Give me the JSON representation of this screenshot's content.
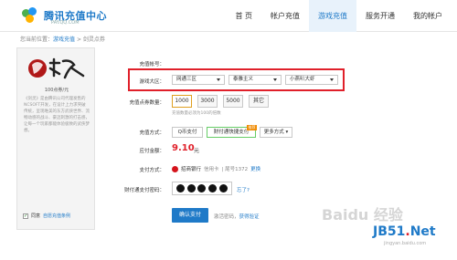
{
  "header": {
    "brand_title": "腾讯充值中心",
    "brand_sub": "PAY.QQ.COM",
    "nav": [
      "首 页",
      "帐户充值",
      "游戏充值",
      "服务开通",
      "我的帐户"
    ]
  },
  "breadcrumb": {
    "prefix": "您当前位置：",
    "link": "游戏充值",
    "sep": " > ",
    "current": "剑灵点券"
  },
  "sidebar": {
    "game_price": "100点券/元",
    "game_desc": "《剑灵》是由腾讯公司代理发售的NCSOFT开发，在设计上力求突破传统，呈现唯美的东方武侠世界、流畅动感的战斗、豪迈刺激的打击感，让每一个玩家都能体验极致的武侠梦想。",
    "agree_text": "同意",
    "agree_link": "自愿充值条例"
  },
  "form": {
    "account_label": "充值帐号：",
    "region_label": "游戏大区：",
    "region_values": [
      "网通三区",
      "泰雅主义",
      "小燕叭大虾"
    ],
    "qty_label": "充值点券数量：",
    "qty_options": [
      "1000",
      "3000",
      "5000",
      "其它"
    ],
    "qty_hint": "充值数量必须为100的倍数",
    "pay_label": "充值方式：",
    "pay_options": [
      "Q币支付",
      "财付通快捷支付",
      "更多方式"
    ],
    "hot_badge": "推荐",
    "amount_label": "应付金额：",
    "amount_value": "9.10",
    "amount_unit": "元",
    "method_label": "支付方式：",
    "bank_name": "招商银行",
    "card_type": "信用卡",
    "tail": "| 尾号1372",
    "change": "更换",
    "pwd_label": "财付通支付密码：",
    "forgot": "忘了?",
    "confirm": "确认支付",
    "after_text": "激活密码，",
    "after_link": "获得验证"
  },
  "watermark": {
    "text": "Baidu 经验",
    "jb": "JB51",
    "jb_dot": ".",
    "jb_net": "Net",
    "jb_sub": "jingyan.baidu.com"
  },
  "colors": {
    "accent": "#1f7ac8",
    "highlight": "#e0202a",
    "hot": "#f08a00"
  }
}
